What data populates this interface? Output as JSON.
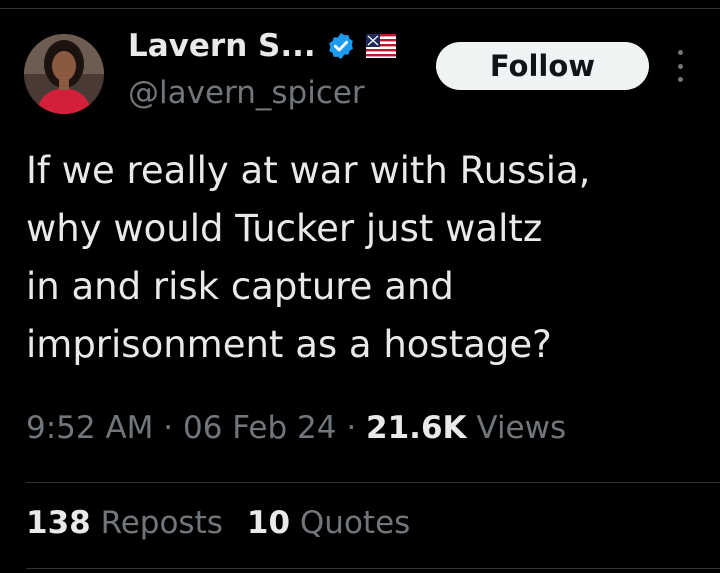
{
  "author": {
    "display_name": "Lavern S...",
    "handle": "@lavern_spicer",
    "verified_icon": "verified-badge-icon",
    "flag_icon": "american-flag-icon"
  },
  "follow_button": {
    "label": "Follow"
  },
  "more_icon": "more-options-icon",
  "tweet": {
    "lines": [
      "If we really at war with Russia,",
      "why would Tucker just waltz",
      "in and risk capture and",
      "imprisonment as a hostage?"
    ]
  },
  "meta": {
    "time": "9:52 AM",
    "sep1": " · ",
    "date": "06 Feb 24",
    "sep2": " · ",
    "views_count": "21.6K",
    "views_label": " Views"
  },
  "stats": {
    "reposts_count": "138",
    "reposts_label": " Reposts",
    "quotes_count": "10",
    "quotes_label": " Quotes"
  },
  "colors": {
    "background": "#000000",
    "text_primary": "#e7e9ea",
    "text_secondary": "#71767b",
    "verified_blue": "#1d9bf0",
    "follow_bg": "#eff3f4"
  }
}
